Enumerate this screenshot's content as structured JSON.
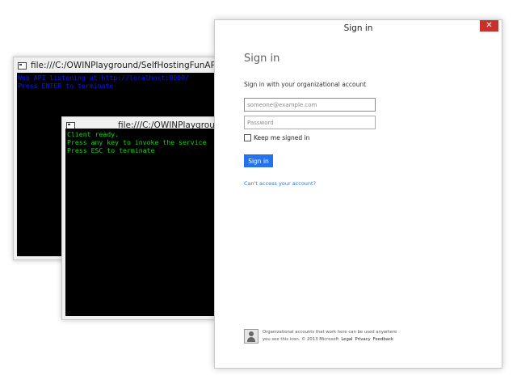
{
  "server_console": {
    "title": "file:///C:/OWINPlayground/SelfHostingFunAPI/SelfHostingFun",
    "lines": "Web API listening at http://localhost:9000/\nPress ENTER to terminate"
  },
  "client_console": {
    "title": "file:///C:/OWINPlayground/SelfH",
    "lines": "Client ready.\nPress any key to invoke the service\nPress ESC to terminate"
  },
  "signin": {
    "window_title": "Sign in",
    "close_glyph": "✕",
    "heading": "Sign in",
    "subheading": "Sign in with your organizational account",
    "email_placeholder": "someone@example.com",
    "password_placeholder": "Password",
    "keep_signed_in": "Keep me signed in",
    "button": "Sign in",
    "cant_access": "Can't access your account?",
    "footer": {
      "text_line1": "Organizational accounts that work here can be used anywhere",
      "text_line2": "you see this icon. © 2013 Microsoft",
      "legal": "Legal",
      "privacy": "Privacy",
      "feedback": "Feedback"
    },
    "accent_color": "#2672ec",
    "close_color": "#c7312c"
  }
}
